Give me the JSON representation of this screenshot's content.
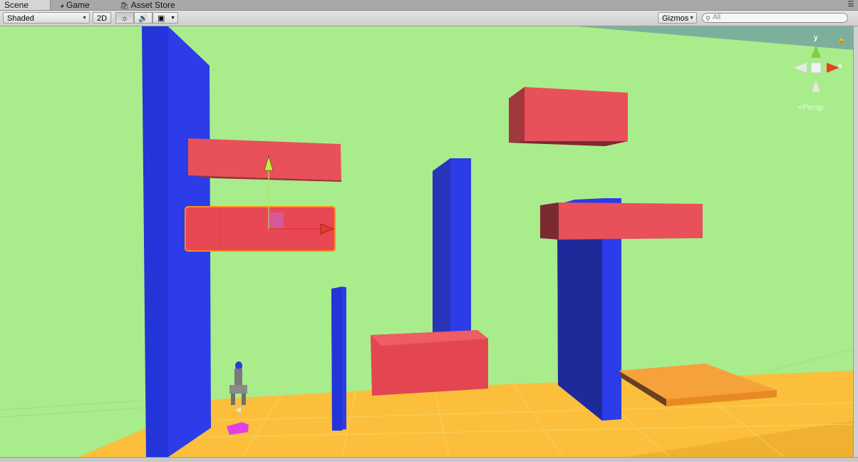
{
  "tabs": [
    {
      "label": "Scene",
      "active": true,
      "icon": "scene-icon"
    },
    {
      "label": "Game",
      "active": false,
      "icon": "pacman-icon"
    },
    {
      "label": "Asset Store",
      "active": false,
      "icon": "bag-icon"
    }
  ],
  "toolbar": {
    "draw_mode": "Shaded",
    "mode_2d": "2D",
    "gizmos_label": "Gizmos",
    "search_placeholder": "All"
  },
  "gizmo": {
    "y_label": "y",
    "x_label": "x",
    "projection_label": "Persp"
  },
  "colors": {
    "sky": "#a9ec8c",
    "ground": "#fbbf3c",
    "blue": "#2c3ce8",
    "red": "#e8505a",
    "orange": "#f6a23a",
    "selection": "#ff8a1e"
  }
}
